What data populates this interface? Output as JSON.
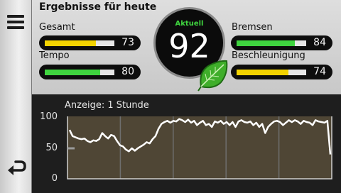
{
  "header": {
    "title": "Ergebnisse für heute"
  },
  "metrics": {
    "gesamt": {
      "label": "Gesamt",
      "value": "73",
      "fill": 0.73,
      "color": "#f3d300"
    },
    "tempo": {
      "label": "Tempo",
      "value": "80",
      "fill": 0.8,
      "color": "#3fd43f"
    },
    "bremsen": {
      "label": "Bremsen",
      "value": "84",
      "fill": 0.84,
      "color": "#3fd43f"
    },
    "beschleunigung": {
      "label": "Beschleunigung",
      "value": "74",
      "fill": 0.74,
      "color": "#f3d300"
    }
  },
  "score": {
    "label": "Aktuell",
    "value": "92"
  },
  "chart_caption": "Anzeige: 1 Stunde",
  "chart_data": {
    "type": "line",
    "ylim": [
      0,
      100
    ],
    "yticks": [
      "100",
      "50",
      "0"
    ],
    "grid": true,
    "series": [
      {
        "values": [
          80,
          70,
          68,
          66,
          65,
          66,
          62,
          60,
          63,
          62,
          65,
          75,
          70,
          66,
          72,
          70,
          62,
          55,
          53,
          48,
          45,
          50,
          46,
          50,
          53,
          56,
          60,
          58,
          65,
          70,
          82,
          90,
          93,
          95,
          92,
          95,
          94,
          98,
          96,
          93,
          97,
          92,
          95,
          88,
          92,
          95,
          88,
          90,
          85,
          94,
          92,
          95,
          90,
          93,
          88,
          93,
          85,
          94,
          96,
          93,
          92,
          94,
          88,
          92,
          85,
          90,
          75,
          85,
          90,
          94,
          95,
          93,
          88,
          92,
          96,
          93,
          96,
          94,
          90,
          95,
          93,
          92,
          88,
          96,
          94,
          93,
          92,
          95,
          40
        ]
      }
    ],
    "colors": {
      "line": "#ffffff",
      "area": "#4f4635",
      "grid": "#6e6e6e"
    }
  },
  "icons": {
    "menu": "menu-icon",
    "back": "back-icon",
    "leaf": "leaf-icon"
  }
}
